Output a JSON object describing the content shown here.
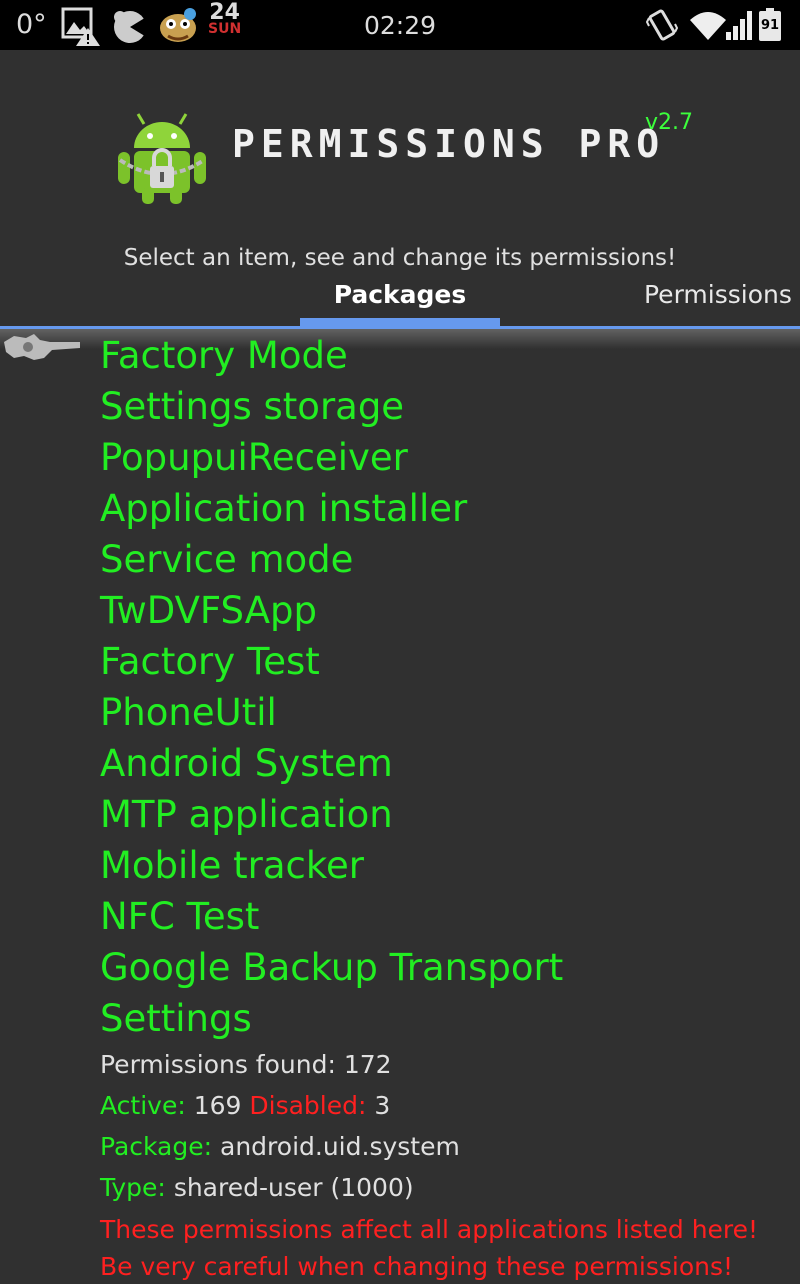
{
  "statusbar": {
    "temperature": "0°",
    "date_day": "24",
    "date_weekday": "SUN",
    "time": "02:29",
    "battery": "91"
  },
  "app": {
    "title": "PERMISSIONS PRO",
    "version": "v2.7",
    "subtitle": "Select an item, see and change its permissions!"
  },
  "tabs": [
    {
      "label": "Packages",
      "selected": true
    },
    {
      "label": "Permissions",
      "selected": false
    }
  ],
  "packages": [
    "Factory Mode",
    "Settings storage",
    "PopupuiReceiver",
    "Application installer",
    "Service mode",
    "TwDVFSApp",
    "Factory Test",
    "PhoneUtil",
    "Android System",
    "MTP application",
    "Mobile tracker",
    "NFC Test",
    "Google Backup Transport",
    "Settings"
  ],
  "info": {
    "permissions_found_label": "Permissions found:",
    "permissions_found_value": "172",
    "active_label": "Active:",
    "active_value": "169",
    "disabled_label": "Disabled:",
    "disabled_value": "3",
    "package_label": "Package:",
    "package_value": "android.uid.system",
    "type_label": "Type:",
    "type_value": "shared-user (1000)",
    "warning_line1": "These permissions affect all applications listed here!",
    "warning_line2": "Be very careful when changing these permissions!"
  },
  "colors": {
    "accent": "#6699ee",
    "package_text": "#22ee22",
    "warning": "#ff2020",
    "background": "#303030"
  }
}
